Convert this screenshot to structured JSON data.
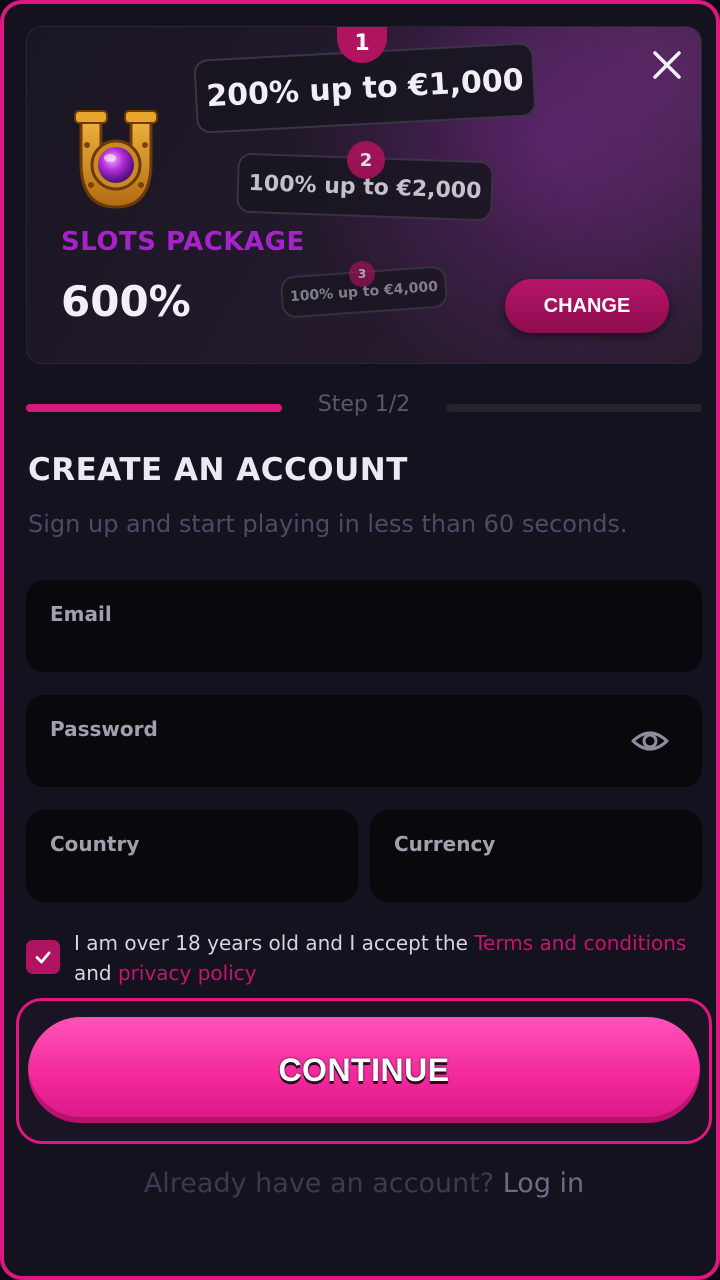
{
  "banner": {
    "tiers": [
      {
        "num": "1",
        "text": "200% up to €1,000"
      },
      {
        "num": "2",
        "text": "100% up to €2,000"
      },
      {
        "num": "3",
        "text": "100% up to €4,000"
      }
    ],
    "package_title": "SLOTS PACKAGE",
    "package_percent": "600%",
    "change_label": "CHANGE"
  },
  "step": {
    "label": "Step 1/2",
    "progress": 0.5
  },
  "form": {
    "heading": "CREATE AN ACCOUNT",
    "subtext": "Sign up and start playing in less than 60 seconds.",
    "email_label": "Email",
    "password_label": "Password",
    "country_label": "Country",
    "currency_label": "Currency"
  },
  "consent": {
    "checked": true,
    "text_before": "I am over 18 years old and I accept the ",
    "terms_link": "Terms and conditions",
    "text_middle": " and ",
    "privacy_link": "privacy policy"
  },
  "continue_label": "CONTINUE",
  "footer": {
    "prompt": "Already have an account?",
    "login_link": "Log in"
  },
  "colors": {
    "accent": "#e0177f",
    "button_pink": "#f3299c",
    "package_purple": "#a523c9",
    "background": "#14121e"
  }
}
